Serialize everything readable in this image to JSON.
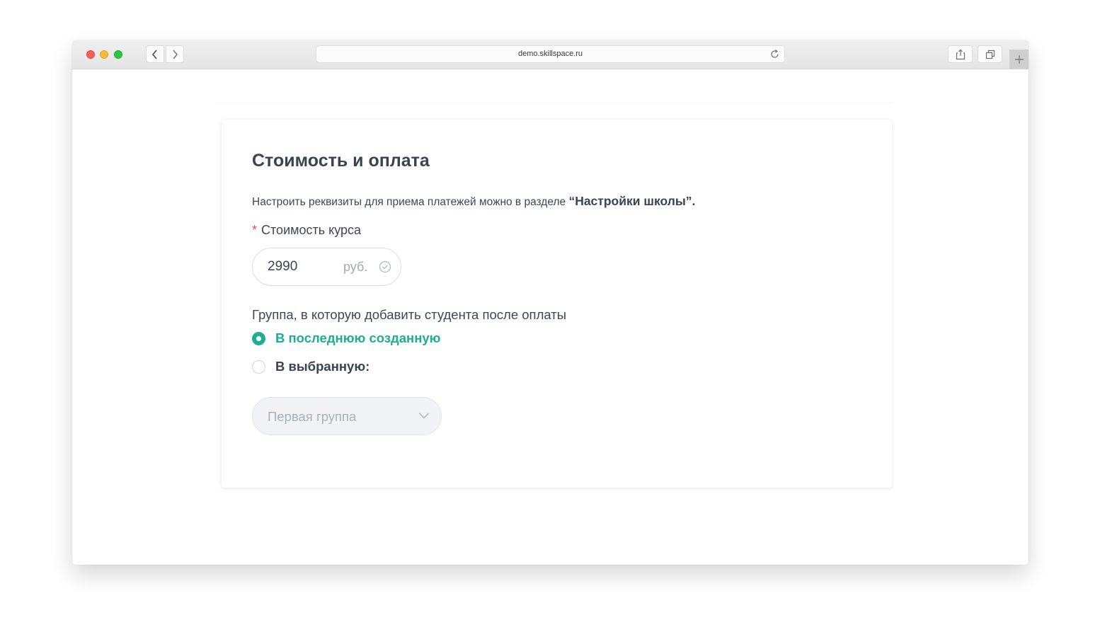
{
  "browser": {
    "url": "demo.skillspace.ru",
    "colors": {
      "close": "#fc5f57",
      "minimize": "#fdbc2e",
      "zoom": "#29c941"
    }
  },
  "card": {
    "title": "Стоимость и оплата",
    "description_prefix": "Настроить реквизиты для приема платежей можно в разделе ",
    "description_link": "“Настройки школы”.",
    "price": {
      "required_mark": "*",
      "label": "Стоимость курса",
      "value": "2990",
      "unit": "руб."
    },
    "group": {
      "label": "Группа, в которую добавить студента после оплаты",
      "options": [
        {
          "label": "В последнюю созданную",
          "selected": true
        },
        {
          "label": "В выбранную:",
          "selected": false
        }
      ],
      "select_value": "Первая группа"
    }
  },
  "colors": {
    "accent": "#1fae8e",
    "required": "#ef4a55",
    "heading": "#3a4352"
  }
}
